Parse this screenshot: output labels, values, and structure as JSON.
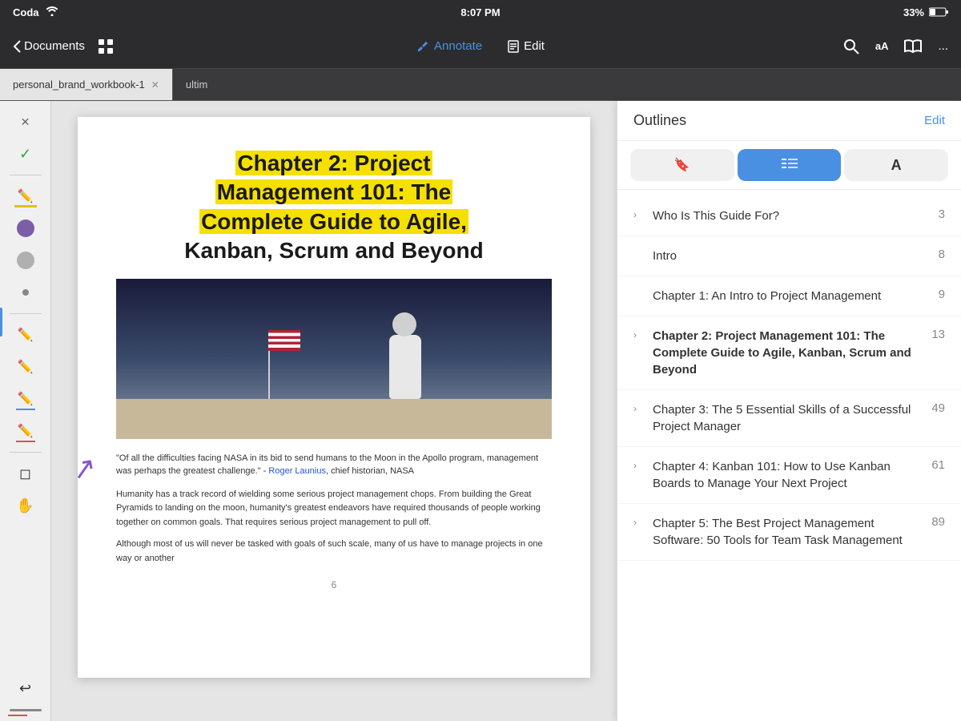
{
  "statusBar": {
    "appName": "Coda",
    "wifiIcon": "wifi",
    "signalIcon": "signal",
    "time": "8:07 PM",
    "batteryPercent": "33%",
    "batteryIcon": "battery"
  },
  "toolbar": {
    "backLabel": "Documents",
    "gridIcon": "grid",
    "annotateLabel": "Annotate",
    "editLabel": "Edit",
    "searchIcon": "search",
    "fontIcon": "aA",
    "bookIcon": "book",
    "moreIcon": "..."
  },
  "tabs": [
    {
      "id": "tab1",
      "label": "personal_brand_workbook-1",
      "active": true
    },
    {
      "id": "tab2",
      "label": "ultim",
      "active": false
    }
  ],
  "document": {
    "chapterTitleLine1": "Chapter 2: Project",
    "chapterTitleLine2": "Management 101: The",
    "chapterTitleLine3": "Complete Guide to Agile,",
    "chapterTitleLine4": "Kanban, Scrum and Beyond",
    "quote": "\"Of all the difficulties facing NASA in its bid to send humans to the Moon in the Apollo program, management was perhaps the greatest challenge.\" - Roger Launius, chief historian, NASA",
    "body1": "Humanity has a track record of wielding some serious project management chops. From building the Great Pyramids to landing on the moon, humanity's greatest endeavors have required thousands of people working together on common goals. That requires serious project management to pull off.",
    "body2": "Although most of us will never be tasked with goals of such scale, many of us have to manage projects in one way or another",
    "pageNumber": "6"
  },
  "outlines": {
    "title": "Outlines",
    "editLabel": "Edit",
    "tabs": [
      {
        "id": "bookmarks",
        "icon": "🔖",
        "active": false
      },
      {
        "id": "list",
        "icon": "≡",
        "active": true
      },
      {
        "id": "font",
        "icon": "A",
        "active": false
      }
    ],
    "items": [
      {
        "id": 1,
        "hasChevron": true,
        "text": "Who Is This Guide For?",
        "page": "3",
        "bold": false
      },
      {
        "id": 2,
        "hasChevron": false,
        "text": "Intro",
        "page": "8",
        "bold": false
      },
      {
        "id": 3,
        "hasChevron": false,
        "text": "Chapter 1: An Intro to Project Management",
        "page": "9",
        "bold": false
      },
      {
        "id": 4,
        "hasChevron": true,
        "text": "Chapter 2: Project Management 101: The Complete Guide to Agile, Kanban, Scrum and Beyond",
        "page": "13",
        "bold": true
      },
      {
        "id": 5,
        "hasChevron": true,
        "text": "Chapter 3: The 5 Essential Skills of a Successful Project Manager",
        "page": "49",
        "bold": false
      },
      {
        "id": 6,
        "hasChevron": true,
        "text": "Chapter 4: Kanban 101: How to Use Kanban Boards to Manage Your Next Project",
        "page": "61",
        "bold": false
      },
      {
        "id": 7,
        "hasChevron": true,
        "text": "Chapter 5: The Best Project Management Software: 50 Tools for Team Task Management",
        "page": "89",
        "bold": false
      }
    ]
  },
  "leftToolbar": {
    "tools": [
      {
        "id": "close",
        "icon": "✕",
        "label": "close-tool"
      },
      {
        "id": "check",
        "icon": "✓",
        "label": "check-tool"
      },
      {
        "id": "pen",
        "icon": "✏",
        "label": "pen-tool",
        "underlineColor": "#ffd700"
      },
      {
        "id": "color-purple",
        "label": "color-purple"
      },
      {
        "id": "color-gray",
        "label": "color-gray"
      },
      {
        "id": "color-dot",
        "label": "color-dot"
      },
      {
        "id": "pencil",
        "icon": "✏",
        "label": "pencil-tool",
        "underlineColor": "transparent"
      },
      {
        "id": "marker-red",
        "icon": "✏",
        "label": "marker-red"
      },
      {
        "id": "marker-blue",
        "icon": "✏",
        "label": "marker-blue"
      },
      {
        "id": "marker-red2",
        "icon": "✏",
        "label": "marker-red2"
      },
      {
        "id": "eraser",
        "icon": "◻",
        "label": "eraser-tool"
      },
      {
        "id": "hand",
        "icon": "✋",
        "label": "hand-tool"
      },
      {
        "id": "undo",
        "icon": "↩",
        "label": "undo-tool"
      }
    ]
  }
}
